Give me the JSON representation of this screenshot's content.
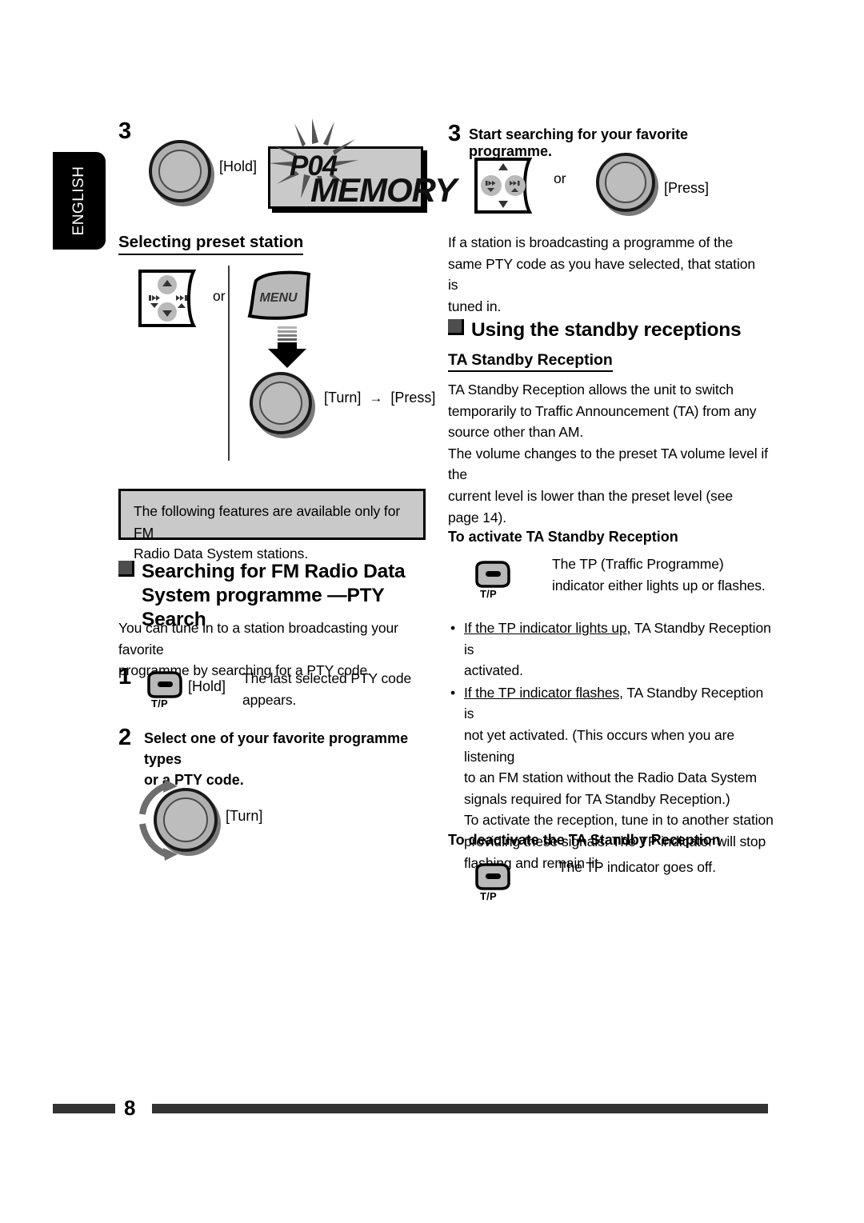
{
  "page": {
    "language_tab": "ENGLISH",
    "page_number": "8"
  },
  "left_column": {
    "step3": {
      "number": "3",
      "knob_label": "[Hold]",
      "display": {
        "line1": "P04",
        "line2": "MEMORY"
      }
    },
    "preset_section": {
      "heading": "Selecting preset station",
      "or_label": "or",
      "menu_button_label": "MENU",
      "knob_label": "[Turn]  [Press]",
      "knob_label_turn": "[Turn]",
      "knob_label_arrow": "→",
      "knob_label_press": "[Press]"
    },
    "note_box": {
      "line1": "The following features are available only for FM",
      "line2": "Radio Data System stations."
    },
    "pty_section": {
      "heading_line1": "Searching for FM Radio Data",
      "heading_line2": "System programme —PTY Search",
      "intro_line1": "You can tune in to a station broadcasting your favorite",
      "intro_line2": "programme by searching for a PTY code.",
      "step1": {
        "number": "1",
        "button_label": "T/P",
        "action": "[Hold]",
        "result_line1": "The last selected PTY code",
        "result_line2": "appears."
      },
      "step2": {
        "number": "2",
        "title_line1": "Select one of your favorite programme types",
        "title_line2": "or a PTY code.",
        "knob_label": "[Turn]"
      }
    }
  },
  "right_column": {
    "step3": {
      "number": "3",
      "title": "Start searching for your favorite programme.",
      "or_label": "or",
      "knob_label": "[Press]",
      "body_line1": "If a station is broadcasting a programme of the",
      "body_line2": "same PTY code as you have selected, that station is",
      "body_line3": "tuned in."
    },
    "standby_section": {
      "heading": "Using the standby receptions",
      "subheading": "TA Standby Reception",
      "body_line1": "TA Standby Reception allows the unit to switch",
      "body_line2": "temporarily to Traffic Announcement (TA) from any",
      "body_line3": "source other than AM.",
      "body_line4": "The volume changes to the preset TA volume level if the",
      "body_line5": "current level is lower than the preset level (see",
      "body_line6": "page 14).",
      "activate": {
        "title": "To activate TA Standby Reception",
        "button_label": "T/P",
        "text_line1": "The TP (Traffic Programme)",
        "text_line2": "indicator either lights up or flashes.",
        "bullets": [
          {
            "underlined": "If the TP indicator lights up,",
            "rest": " TA Standby Reception is",
            "continuation": "activated."
          },
          {
            "underlined": "If the TP indicator flashes,",
            "rest": " TA Standby Reception is",
            "continuation": "not yet activated. (This occurs when you are listening"
          }
        ],
        "cont_line1": "to an FM station without the Radio Data System",
        "cont_line2": "signals required for TA Standby Reception.)",
        "cont_line3": "To activate the reception, tune in to another station",
        "cont_line4": "providing these signals. The TP indicator will stop",
        "cont_line5": "flashing and remain lit."
      },
      "deactivate": {
        "title": "To deactivate the TA Standby Reception",
        "button_label": "T/P",
        "text": "The TP indicator goes off."
      }
    }
  },
  "colors": {
    "tab_background": "#000000",
    "note_fill": "#c9c9c9",
    "display_fill": "#c9c9c9",
    "knob_fill": "#b0b0b0",
    "footer_bar": "#333333"
  }
}
